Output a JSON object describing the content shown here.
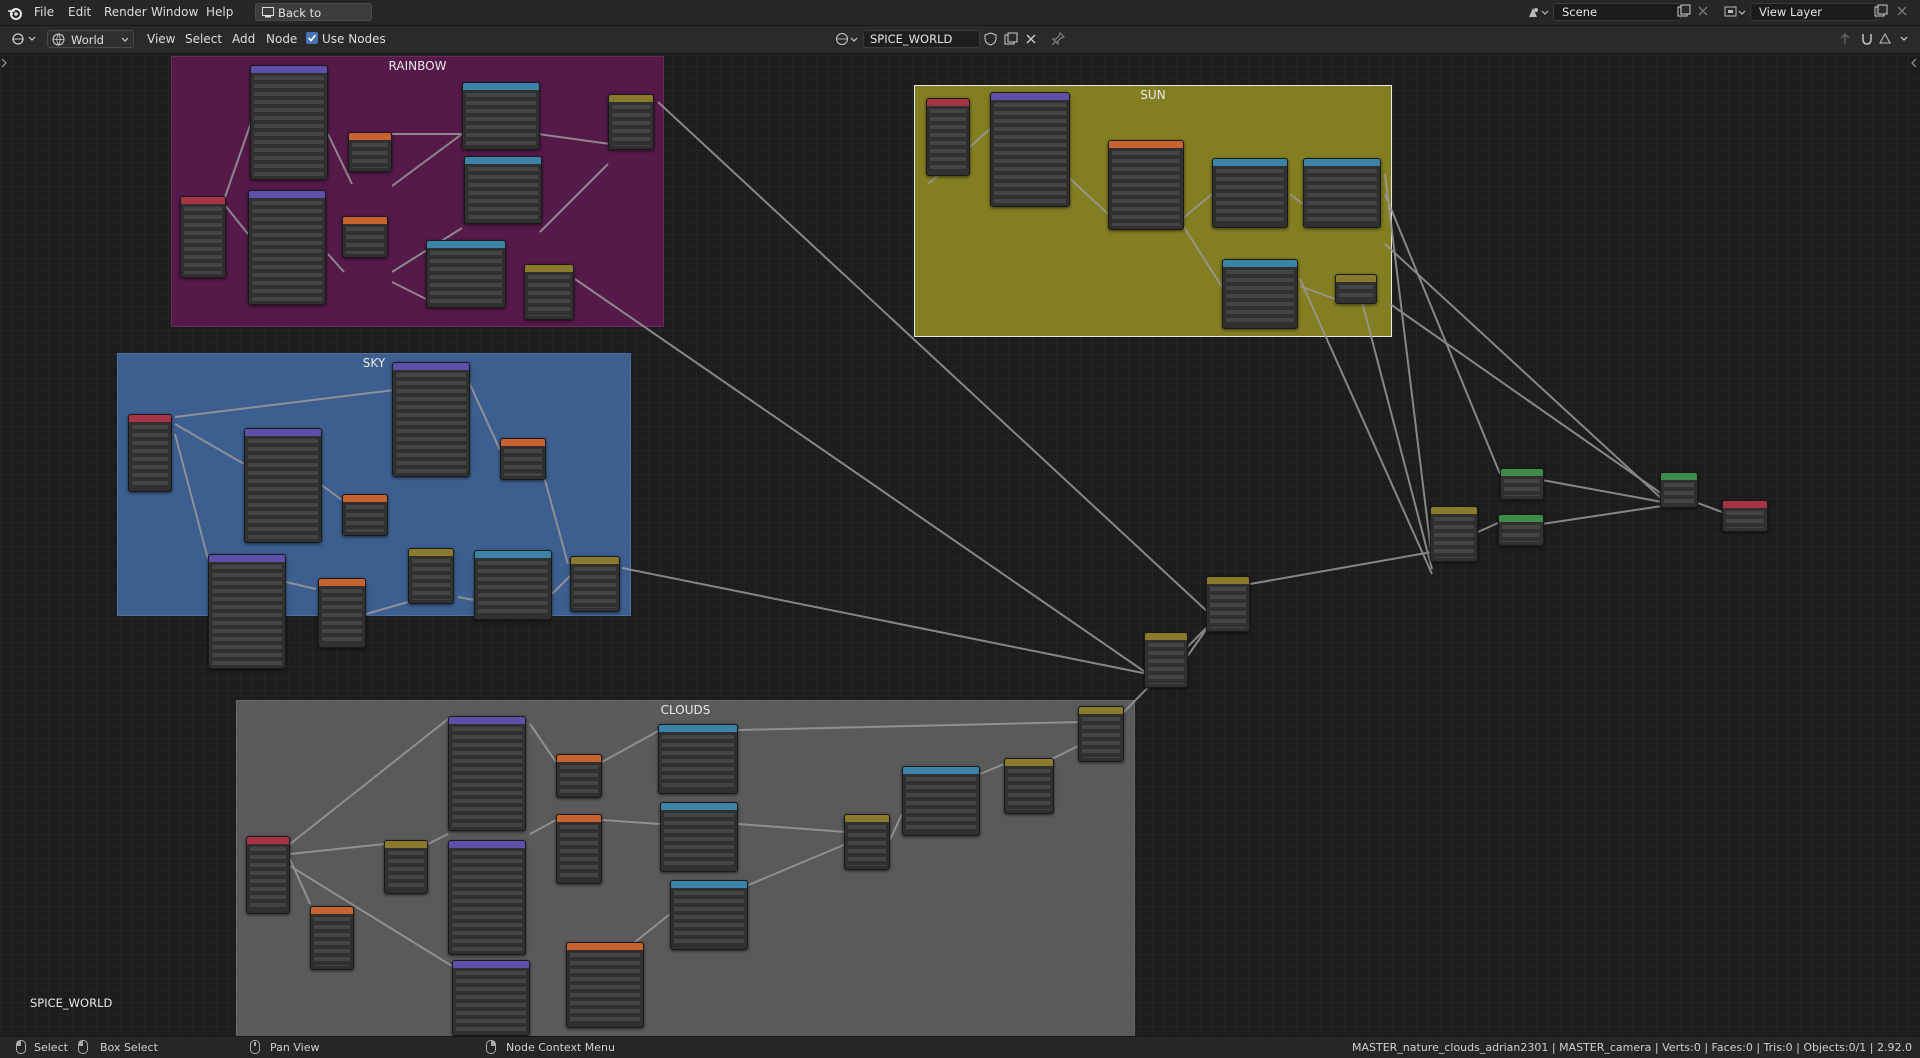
{
  "menubar": {
    "items": [
      "File",
      "Edit",
      "Render",
      "Window",
      "Help"
    ],
    "back_button": "Back to Previous",
    "scene": "Scene",
    "view_layer": "View Layer"
  },
  "editor_header": {
    "shader_type": "World",
    "menus": [
      "View",
      "Select",
      "Add",
      "Node"
    ],
    "use_nodes_label": "Use Nodes",
    "use_nodes_checked": true,
    "world_name": "SPICE_WORLD"
  },
  "frames": {
    "rainbow": {
      "label": "RAINBOW",
      "color": "#5a1a4a"
    },
    "sun": {
      "label": "SUN",
      "color": "#8a8420"
    },
    "sky": {
      "label": "SKY",
      "color": "#3e5f90"
    },
    "clouds": {
      "label": "CLOUDS",
      "color": "#5c5c5c"
    }
  },
  "canvas_overlay": {
    "world_label": "SPICE_WORLD"
  },
  "statusbar": {
    "select": "Select",
    "box_select": "Box Select",
    "pan_view": "Pan View",
    "context_menu": "Node Context Menu",
    "info": "MASTER_nature_clouds_adrian2301 | MASTER_camera | Verts:0 | Faces:0 | Tris:0 | Objects:0/1 | 2.92.0"
  },
  "node_colors": {
    "input": "#a53546",
    "vector": "#5e4fa8",
    "texture": "#c8632f",
    "converter": "#3b84a8",
    "color_mix": "#8a7a2d",
    "shader": "#3f8a4a",
    "output": "#a53546"
  }
}
